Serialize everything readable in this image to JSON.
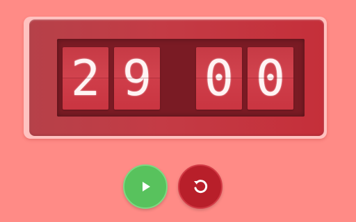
{
  "timer": {
    "digits": [
      "2",
      "9",
      "0",
      "0"
    ],
    "colors": {
      "background": "#ff8b86",
      "panel": "#c43b45",
      "digit": "#fff4f4"
    }
  },
  "controls": {
    "play": {
      "icon": "play-icon",
      "color": "#58c25d"
    },
    "reset": {
      "icon": "reset-icon",
      "color": "#b81f2a"
    }
  }
}
